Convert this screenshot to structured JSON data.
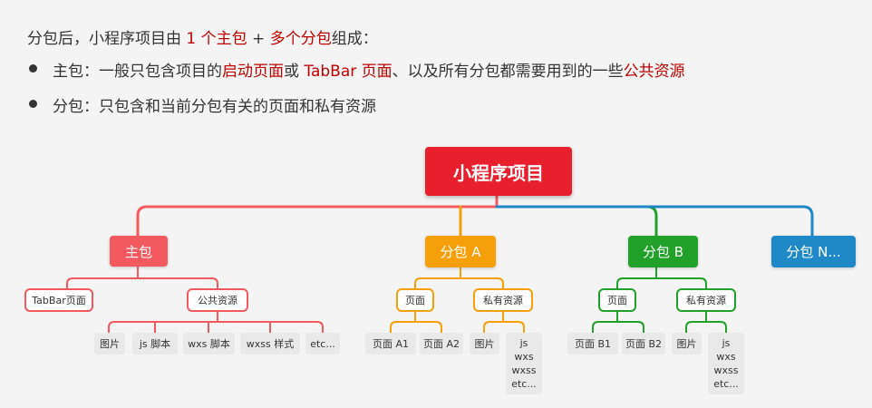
{
  "intro": {
    "prefix": "分包后，小程序项目由 ",
    "highlight1": "1 个主包",
    "middle": " + ",
    "highlight2": "多个分包",
    "suffix": "组成："
  },
  "bullets": [
    {
      "text_a": "主包：一般只包含项目的",
      "hl_a": "启动页面",
      "text_b": "或 ",
      "hl_b": "TabBar 页面",
      "text_c": "、以及所有分包都需要用到的一些",
      "hl_c": "公共资源"
    },
    {
      "text_a": "分包：只包含和当前分包有关的页面和私有资源"
    }
  ],
  "colors": {
    "highlight": "#c00000",
    "root": "#e8202e",
    "main": "#f25a5f",
    "subA": "#f5a00a",
    "subB": "#22a12a",
    "subN": "#1f88c7"
  },
  "tree": {
    "root": {
      "label": "小程序项目"
    },
    "main": {
      "label": "主包",
      "children": [
        {
          "label": "TabBar页面"
        },
        {
          "label": "公共资源",
          "leaves": [
            "图片",
            "js 脚本",
            "wxs 脚本",
            "wxss 样式",
            "etc..."
          ]
        }
      ]
    },
    "subA": {
      "label": "分包 A",
      "children": [
        {
          "label": "页面",
          "leaves": [
            "页面 A1",
            "页面 A2"
          ]
        },
        {
          "label": "私有资源",
          "leaves": [
            "图片",
            [
              "js",
              "wxs",
              "wxss",
              "etc..."
            ]
          ]
        }
      ]
    },
    "subB": {
      "label": "分包 B",
      "children": [
        {
          "label": "页面",
          "leaves": [
            "页面 B1",
            "页面 B2"
          ]
        },
        {
          "label": "私有资源",
          "leaves": [
            "图片",
            [
              "js",
              "wxs",
              "wxss",
              "etc..."
            ]
          ]
        }
      ]
    },
    "subN": {
      "label": "分包 N..."
    }
  }
}
